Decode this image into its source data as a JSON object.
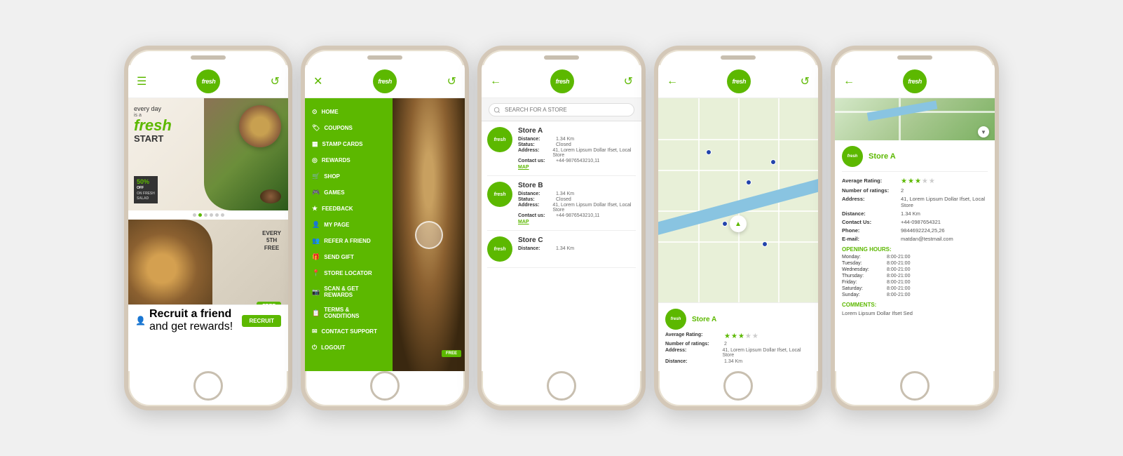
{
  "app": {
    "logo_text": "fresh",
    "accent_color": "#5cb800"
  },
  "phone1": {
    "banner": {
      "every_day": "every day",
      "is_a": "is a",
      "fresh": "fresh",
      "start": "START",
      "badge_percent": "50%",
      "badge_off": "OFF",
      "badge_text": "ON FRESH\nSALAD"
    },
    "banner2": {
      "every5th": "EVERY\n5TH\nFREE",
      "free_label": "FREE"
    },
    "recruit": {
      "title": "Recruit a friend",
      "subtitle": "and get rewards!",
      "button": "RECRUIT"
    }
  },
  "phone2": {
    "menu_items": [
      {
        "icon": "⊙",
        "label": "HOME"
      },
      {
        "icon": "🏷",
        "label": "COUPONS"
      },
      {
        "icon": "▦",
        "label": "STAMP CARDS"
      },
      {
        "icon": "◎",
        "label": "REWARDS"
      },
      {
        "icon": "🛒",
        "label": "SHOP"
      },
      {
        "icon": "🎮",
        "label": "GAMES"
      },
      {
        "icon": "★",
        "label": "FEEDBACK"
      },
      {
        "icon": "👤",
        "label": "MY PAGE"
      },
      {
        "icon": "👥",
        "label": "REFER A FRIEND"
      },
      {
        "icon": "🎁",
        "label": "SEND GIFT"
      },
      {
        "icon": "📍",
        "label": "STORE LOCATOR"
      },
      {
        "icon": "📷",
        "label": "SCAN & GET REWARDS"
      },
      {
        "icon": "📋",
        "label": "TERMS & CONDITIONS"
      },
      {
        "icon": "✉",
        "label": "CONTACT SUPPORT"
      },
      {
        "icon": "⏻",
        "label": "LOGOUT"
      }
    ]
  },
  "phone3": {
    "search_placeholder": "SEARCH FOR A STORE",
    "stores": [
      {
        "name": "Store A",
        "distance": "1.34 Km",
        "status": "Closed",
        "address": "41, Lorem Lipsum Dollar Ifset, Local Store",
        "contact": "+44-9876543210,11",
        "map_link": "MAP"
      },
      {
        "name": "Store B",
        "distance": "1.34 Km",
        "status": "Closed",
        "address": "41, Lorem Lipsum Dollar Ifset, Local Store",
        "contact": "+44-9876543210,11",
        "map_link": "MAP"
      },
      {
        "name": "Store C",
        "distance": "1.34 Km",
        "status": "",
        "address": "",
        "contact": "",
        "map_link": ""
      }
    ]
  },
  "phone4": {
    "store": {
      "name": "Store A",
      "avg_rating_label": "Average Rating:",
      "num_ratings_label": "Number of ratings:",
      "num_ratings_value": "2",
      "address_label": "Address:",
      "address_value": "41, Lorem Lipsum Dollar Ifset, Local Store",
      "distance_label": "Distance:",
      "distance_value": "1.34 Km",
      "stars_filled": 3,
      "stars_empty": 2
    }
  },
  "phone5": {
    "store": {
      "name": "Store A",
      "avg_rating_label": "Average Rating:",
      "num_ratings_label": "Number of ratings:",
      "num_ratings_value": "2",
      "address_label": "Address:",
      "address_value": "41, Lorem Lipsum Dollar Ifset, Local Store",
      "distance_label": "Distance:",
      "distance_value": "1.34 Km",
      "contact_us_label": "Contact Us:",
      "contact_us_value": "+44-0987654321",
      "phone_label": "Phone:",
      "phone_value": "9844692224,25,26",
      "email_label": "E-mail:",
      "email_value": "matdan@testmail.com",
      "stars_filled": 3,
      "stars_empty": 2
    },
    "opening_hours": {
      "title": "OPENING HOURS:",
      "days": [
        {
          "day": "Monday:",
          "hours": "8:00-21:00"
        },
        {
          "day": "Tuesday:",
          "hours": "8:00-21:00"
        },
        {
          "day": "Wednesday:",
          "hours": "8:00-21:00"
        },
        {
          "day": "Thursday:",
          "hours": "8:00-21:00"
        },
        {
          "day": "Friday:",
          "hours": "8:00-21:00"
        },
        {
          "day": "Saturday:",
          "hours": "8:00-21:00"
        },
        {
          "day": "Sunday:",
          "hours": "8:00-21:00"
        }
      ]
    },
    "comments": {
      "title": "COMMENTS:",
      "text": "Lorem Lipsum Dollar Ifset Sed"
    }
  }
}
